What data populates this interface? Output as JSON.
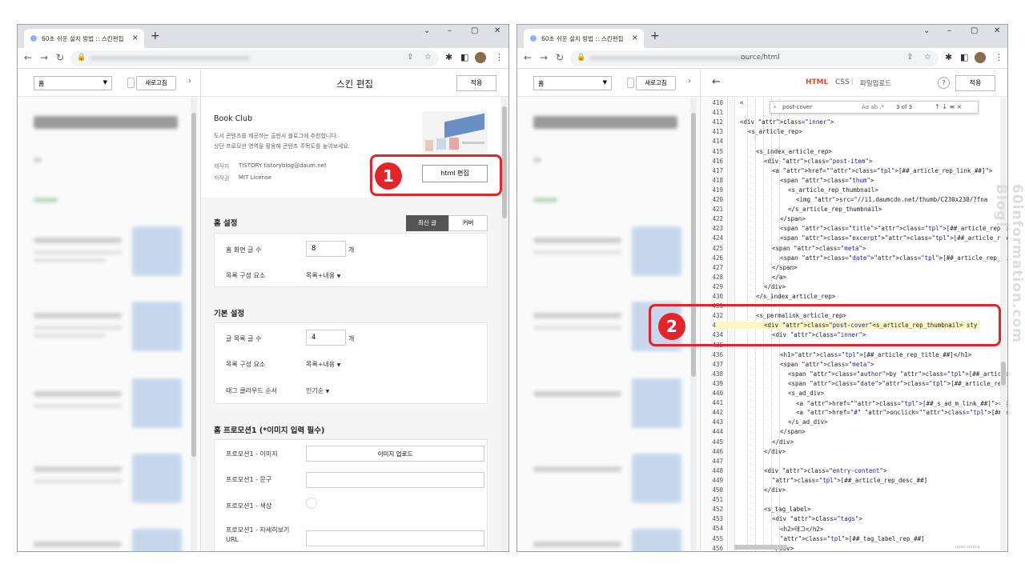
{
  "browser": {
    "tab_title": "60초 쉬운 설치 방법 :: 스킨편집",
    "close_tab": "×",
    "new_tab": "+",
    "url_tail": "ource/html"
  },
  "left": {
    "preview": {
      "select_value": "홈",
      "refresh_label": "새로고침",
      "collapse": "›"
    },
    "editor": {
      "title": "스킨 편집",
      "apply_label": "적용",
      "skin": {
        "name": "Book Club",
        "desc_line1": "도서 콘텐츠를 제공하는 출판사 블로그에 추천합니다.",
        "desc_line2": "상단 프로모션 영역을 활용해 콘텐츠 주목도를 높여보세요.",
        "maker_label": "제작자",
        "maker_value": "TISTORY tistoryblog@daum.net",
        "license_label": "저작권",
        "license_value": "MIT License",
        "html_edit_label": "html 편집"
      },
      "home_settings": {
        "title": "홈 설정",
        "tab_latest": "최신 글",
        "tab_cover": "커버",
        "count_label": "홈 화면 글 수",
        "count_value": "8",
        "unit": "개",
        "list_label": "목록 구성 요소",
        "list_value": "목록+내용"
      },
      "basic_settings": {
        "title": "기본 설정",
        "count_label": "글 목록 글 수",
        "count_value": "4",
        "unit": "개",
        "list_label": "목록 구성 요소",
        "list_value": "목록+내용",
        "tag_label": "태그 클라우드 순서",
        "tag_value": "인기순"
      },
      "promo": {
        "title": "홈 프로모션1 (*이미지 입력 필수)",
        "image_label": "프로모션1 - 이미지",
        "upload_label": "이미지 업로드",
        "text_label": "프로모션1 - 문구",
        "color_label": "프로모션1 - 색상",
        "url_label_1": "프로모션1 - 자세히보기",
        "url_label_2": "URL"
      }
    }
  },
  "right": {
    "preview": {
      "select_value": "홈",
      "refresh_label": "새로고침",
      "collapse": "›"
    },
    "editor": {
      "back": "←",
      "tab_html": "HTML",
      "tab_css": "CSS",
      "tab_upload": "파일업로드",
      "help": "?",
      "apply_label": "적용",
      "find_query": "post-cover",
      "find_opts": "Aa  ab  .*",
      "find_count": "3 of 3",
      "find_nav": "↑  ↓  ≡  ×",
      "footer_hint": "open source"
    },
    "code_lines": [
      {
        "n": "410",
        "i": 0,
        "t": "<",
        ":": ""
      },
      {
        "n": "411",
        "i": 0,
        "t": ""
      },
      {
        "n": "412",
        "i": 0,
        "t": "<div class=\"inner\">"
      },
      {
        "n": "413",
        "i": 1,
        "t": "<s_article_rep>"
      },
      {
        "n": "414",
        "i": 0,
        "t": ""
      },
      {
        "n": "415",
        "i": 2,
        "t": "<s_index_article_rep>"
      },
      {
        "n": "416",
        "i": 3,
        "t": "<div class=\"post-item\">"
      },
      {
        "n": "417",
        "i": 4,
        "t": "<a href=\"[##_article_rep_link_##]\">"
      },
      {
        "n": "418",
        "i": 5,
        "t": "<span class=\"thum\">"
      },
      {
        "n": "419",
        "i": 6,
        "t": "<s_article_rep_thumbnail>"
      },
      {
        "n": "420",
        "i": 7,
        "t": "<img src=\"//i1.daumcdn.net/thumb/C230x230/?fna"
      },
      {
        "n": "421",
        "i": 6,
        "t": "</s_article_rep_thumbnail>"
      },
      {
        "n": "422",
        "i": 5,
        "t": "</span>"
      },
      {
        "n": "423",
        "i": 5,
        "t": "<span class=\"title\">[##_article_rep_title_##]</spa"
      },
      {
        "n": "424",
        "i": 5,
        "t": "<span class=\"excerpt\">[##_article_rep_summary_##]</"
      },
      {
        "n": "425",
        "i": 4,
        "t": "<span class=\"meta\">"
      },
      {
        "n": "426",
        "i": 5,
        "t": "<span class=\"date\">[##_article_rep_simple_date_"
      },
      {
        "n": "427",
        "i": 4,
        "t": "</span>"
      },
      {
        "n": "428",
        "i": 4,
        "t": "</a>"
      },
      {
        "n": "429",
        "i": 3,
        "t": "</div>"
      },
      {
        "n": "430",
        "i": 2,
        "t": "</s_index_article_rep>"
      },
      {
        "n": "431",
        "i": 0,
        "t": ""
      },
      {
        "n": "432",
        "i": 2,
        "t": "<s_permalink_article_rep>"
      },
      {
        "n": "433",
        "i": 3,
        "t": "<div class=\"post-cover\"<s_article_rep_thumbnail> sty"
      },
      {
        "n": "434",
        "i": 4,
        "t": "<div class=\"inner\">"
      },
      {
        "n": "435",
        "i": 0,
        "t": ""
      },
      {
        "n": "436",
        "i": 5,
        "t": "<h1>[##_article_rep_title_##]</h1>"
      },
      {
        "n": "437",
        "i": 5,
        "t": "<span class=\"meta\">"
      },
      {
        "n": "438",
        "i": 6,
        "t": "<span class=\"author\">by [##_article_rep_author"
      },
      {
        "n": "439",
        "i": 6,
        "t": "<span class=\"date\">[##_article_rep_simple_date"
      },
      {
        "n": "440",
        "i": 6,
        "t": "<s_ad_div>"
      },
      {
        "n": "441",
        "i": 7,
        "t": "<a href=\"[##_s_ad_m_link_##]\">수정</a>"
      },
      {
        "n": "442",
        "i": 7,
        "t": "<a href=\"#\" onclick=\"[##_s_ad_d_onclick_##]\">"
      },
      {
        "n": "443",
        "i": 6,
        "t": "</s_ad_div>"
      },
      {
        "n": "444",
        "i": 5,
        "t": "</span>"
      },
      {
        "n": "445",
        "i": 4,
        "t": "</div>"
      },
      {
        "n": "446",
        "i": 3,
        "t": "</div>"
      },
      {
        "n": "447",
        "i": 0,
        "t": ""
      },
      {
        "n": "448",
        "i": 3,
        "t": "<div class=\"entry-content\">"
      },
      {
        "n": "449",
        "i": 4,
        "t": "[##_article_rep_desc_##]"
      },
      {
        "n": "450",
        "i": 3,
        "t": "</div>"
      },
      {
        "n": "451",
        "i": 0,
        "t": ""
      },
      {
        "n": "452",
        "i": 3,
        "t": "<s_tag_label>"
      },
      {
        "n": "453",
        "i": 4,
        "t": "<div class=\"tags\">"
      },
      {
        "n": "454",
        "i": 5,
        "t": "<h2>태그</h2>"
      },
      {
        "n": "455",
        "i": 5,
        "t": "[##_tag_label_rep_##]"
      },
      {
        "n": "456",
        "i": 4,
        "t": "</div>"
      }
    ]
  },
  "annotations": {
    "badge1": "1",
    "badge2": "2"
  },
  "watermark": "60information.com  Blog!"
}
